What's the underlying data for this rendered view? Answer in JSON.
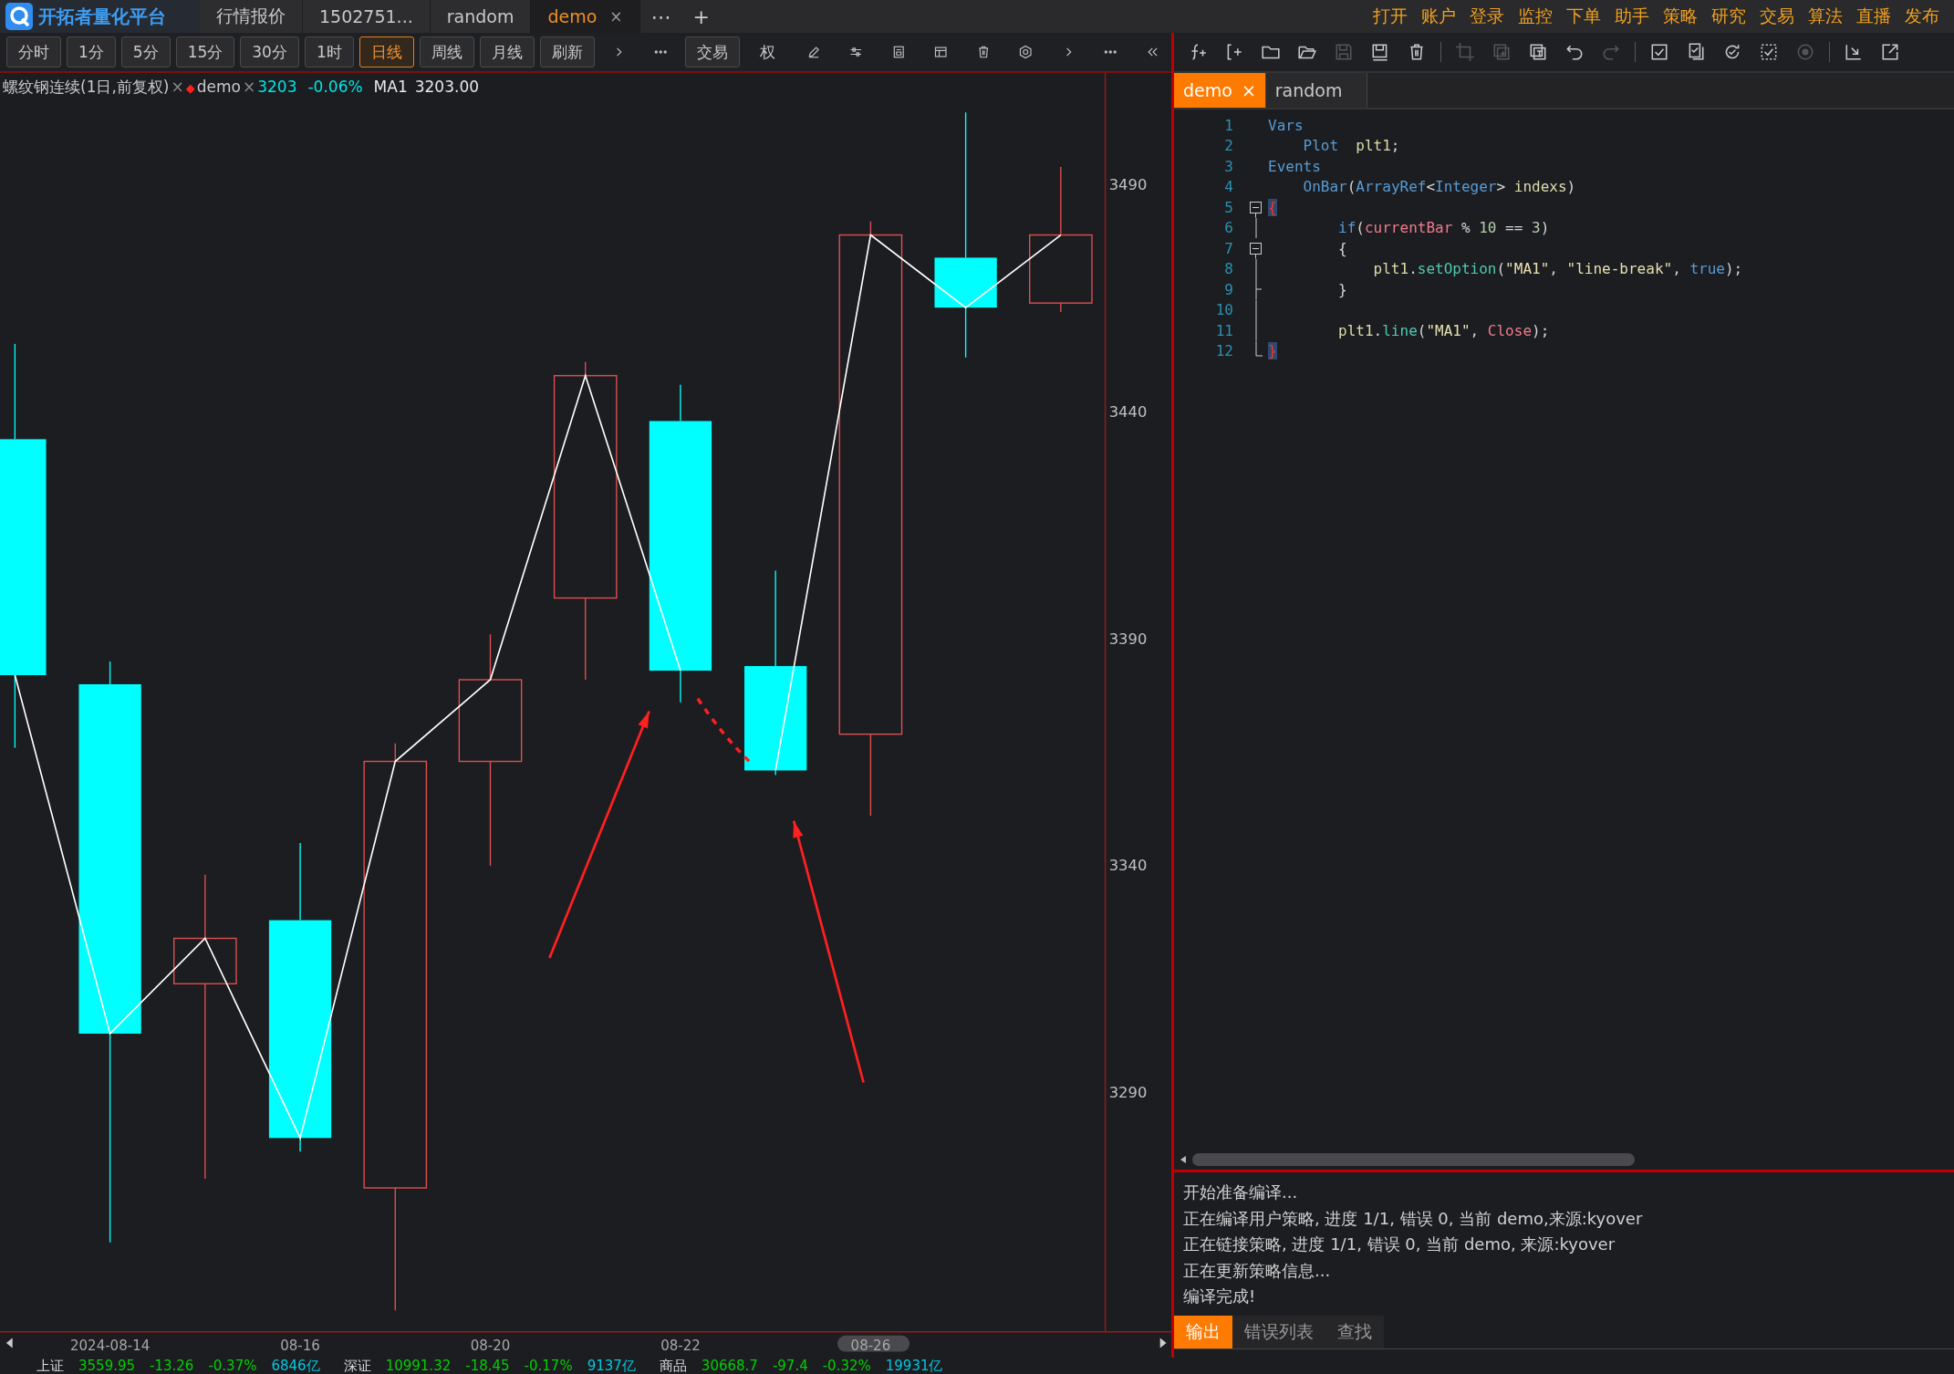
{
  "app": {
    "title": "开拓者量化平台",
    "tabs": [
      {
        "label": "行情报价",
        "selected": false
      },
      {
        "label": "1502751...",
        "selected": false
      },
      {
        "label": "random",
        "selected": false
      },
      {
        "label": "demo",
        "selected": true,
        "close": "×"
      }
    ],
    "more": "⋯",
    "add": "+",
    "menu": [
      "打开",
      "账户",
      "登录",
      "监控",
      "下单",
      "助手",
      "策略",
      "研究",
      "交易",
      "算法",
      "直播",
      "发布"
    ]
  },
  "chart_toolbar": {
    "periods": [
      {
        "label": "分时",
        "selected": false
      },
      {
        "label": "1分",
        "selected": false
      },
      {
        "label": "5分",
        "selected": false
      },
      {
        "label": "15分",
        "selected": false
      },
      {
        "label": "30分",
        "selected": false
      },
      {
        "label": "1时",
        "selected": false
      },
      {
        "label": "日线",
        "selected": true
      },
      {
        "label": "周线",
        "selected": false
      },
      {
        "label": "月线",
        "selected": false
      },
      {
        "label": "刷新",
        "selected": false
      }
    ],
    "tools": [
      {
        "kind": "chevron-right"
      },
      {
        "kind": "more"
      },
      {
        "kind": "text-button",
        "label": "交易"
      },
      {
        "kind": "text",
        "label": "权"
      },
      {
        "kind": "pencil"
      },
      {
        "kind": "sliders"
      },
      {
        "kind": "document"
      },
      {
        "kind": "window"
      },
      {
        "kind": "trash"
      },
      {
        "kind": "hexagon"
      },
      {
        "kind": "chevron-right"
      },
      {
        "kind": "more"
      },
      {
        "kind": "double-chevron-left"
      }
    ]
  },
  "chart_header": {
    "title": "螺纹钢连续(1日,前复权)",
    "close": "×",
    "marker": "◆",
    "strategy": "demo",
    "strategy_close": "×",
    "price": "3203",
    "change": "-0.06%",
    "indicator_value": "3203.00"
  },
  "chart": {
    "chart_data": {
      "type": "line",
      "categories": [
        null,
        "2024-08-14",
        null,
        "08-16",
        null,
        "08-20",
        null,
        "08-22",
        null,
        "08-26",
        null,
        null
      ],
      "ylim": [
        3237.3,
        3514.7
      ],
      "yticks": [
        3290,
        3340,
        3390,
        3440,
        3490
      ],
      "series": [
        {
          "name": "MA1",
          "color": "#ffffff",
          "values": [
            3382,
            3303,
            3324,
            3280,
            3363,
            3381,
            3448,
            3383,
            null,
            null,
            null,
            null
          ]
        },
        {
          "color": "#ffffff",
          "values": [
            null,
            null,
            null,
            null,
            null,
            null,
            null,
            null,
            3361,
            3479,
            3463,
            3479
          ]
        }
      ]
    },
    "marks": [
      {
        "kind": "arrow"
      },
      {
        "kind": "dashed-arc"
      },
      {
        "kind": "arrow"
      }
    ]
  },
  "editor_toolbar": [
    {
      "kind": "function-add",
      "disabled": false
    },
    {
      "kind": "bracket-add",
      "disabled": false
    },
    {
      "kind": "folder",
      "disabled": false
    },
    {
      "kind": "open-folder",
      "disabled": false
    },
    {
      "kind": "save",
      "disabled": true
    },
    {
      "kind": "save-as",
      "disabled": false
    },
    {
      "kind": "trash",
      "disabled": false
    },
    {
      "kind": "separator"
    },
    {
      "kind": "crop",
      "disabled": true
    },
    {
      "kind": "copy",
      "disabled": true
    },
    {
      "kind": "paste",
      "disabled": false
    },
    {
      "kind": "undo",
      "disabled": false
    },
    {
      "kind": "redo",
      "disabled": true
    },
    {
      "kind": "separator"
    },
    {
      "kind": "checkbox",
      "disabled": false
    },
    {
      "kind": "check-document",
      "disabled": false
    },
    {
      "kind": "refresh-check",
      "disabled": false
    },
    {
      "kind": "dashed-check",
      "disabled": false
    },
    {
      "kind": "stop",
      "disabled": true
    },
    {
      "kind": "separator"
    },
    {
      "kind": "import",
      "disabled": false
    },
    {
      "kind": "export",
      "disabled": false
    }
  ],
  "editor": {
    "tabs": [
      {
        "label": "demo",
        "selected": true,
        "close": "×"
      },
      {
        "label": "random",
        "selected": false
      }
    ],
    "lines": [
      {
        "number": "1",
        "kind": "plain",
        "tokens": [
          {
            "kind": "keyword",
            "text": "Vars"
          }
        ]
      },
      {
        "number": "2",
        "kind": "plain",
        "tokens": [
          {
            "kind": "keyword",
            "text": "    Plot"
          },
          {
            "kind": "identifier",
            "text": "  plt1"
          },
          {
            "kind": "plain",
            "text": ";"
          }
        ]
      },
      {
        "number": "3",
        "kind": "plain",
        "tokens": [
          {
            "kind": "keyword",
            "text": "Events"
          }
        ]
      },
      {
        "number": "4",
        "kind": "plain",
        "tokens": [
          {
            "kind": "keyword",
            "text": "    OnBar"
          },
          {
            "kind": "plain",
            "text": "("
          },
          {
            "kind": "keyword",
            "text": "ArrayRef"
          },
          {
            "kind": "plain",
            "text": "<"
          },
          {
            "kind": "keyword",
            "text": "Integer"
          },
          {
            "kind": "plain",
            "text": "> "
          },
          {
            "kind": "identifier",
            "text": "indexs"
          },
          {
            "kind": "plain",
            "text": ")"
          }
        ]
      },
      {
        "number": "5",
        "kind": "fold-open",
        "tokens": [
          {
            "kind": "brace",
            "text": "{"
          }
        ]
      },
      {
        "number": "6",
        "kind": "fold-line",
        "tokens": [
          {
            "kind": "keyword",
            "text": "        if"
          },
          {
            "kind": "plain",
            "text": "("
          },
          {
            "kind": "variable",
            "text": "currentBar"
          },
          {
            "kind": "plain",
            "text": " % "
          },
          {
            "kind": "number",
            "text": "10"
          },
          {
            "kind": "plain",
            "text": " == "
          },
          {
            "kind": "number",
            "text": "3"
          },
          {
            "kind": "plain",
            "text": ")"
          }
        ]
      },
      {
        "number": "7",
        "kind": "fold-open",
        "tokens": [
          {
            "kind": "plain",
            "text": "        {"
          }
        ]
      },
      {
        "number": "8",
        "kind": "fold-line",
        "tokens": [
          {
            "kind": "identifier",
            "text": "            plt1"
          },
          {
            "kind": "plain",
            "text": "."
          },
          {
            "kind": "function",
            "text": "setOption"
          },
          {
            "kind": "plain",
            "text": "("
          },
          {
            "kind": "string",
            "text": "\"MA1\""
          },
          {
            "kind": "plain",
            "text": ", "
          },
          {
            "kind": "string",
            "text": "\"line-break\""
          },
          {
            "kind": "plain",
            "text": ", "
          },
          {
            "kind": "keyword",
            "text": "true"
          },
          {
            "kind": "plain",
            "text": ");"
          }
        ]
      },
      {
        "number": "9",
        "kind": "fold-tick",
        "tokens": [
          {
            "kind": "plain",
            "text": "        }"
          }
        ]
      },
      {
        "number": "10",
        "kind": "fold-line"
      },
      {
        "number": "11",
        "kind": "fold-line",
        "tokens": [
          {
            "kind": "identifier",
            "text": "        plt1"
          },
          {
            "kind": "plain",
            "text": "."
          },
          {
            "kind": "function",
            "text": "line"
          },
          {
            "kind": "plain",
            "text": "("
          },
          {
            "kind": "string",
            "text": "\"MA1\""
          },
          {
            "kind": "plain",
            "text": ", "
          },
          {
            "kind": "variable",
            "text": "Close"
          },
          {
            "kind": "plain",
            "text": ");"
          }
        ]
      },
      {
        "number": "12",
        "kind": "fold-end",
        "tokens": [
          {
            "kind": "brace",
            "text": "}"
          }
        ]
      }
    ]
  },
  "output": {
    "lines": [
      "开始准备编译...",
      "正在编译用户策略, 进度 1/1, 错误 0, 当前 demo,来源:kyover",
      "正在链接策略, 进度 1/1, 错误 0, 当前 demo, 来源:kyover",
      "正在更新策略信息...",
      "编译完成!"
    ],
    "tabs": [
      {
        "label": "输出",
        "selected": true
      },
      {
        "label": "错误列表",
        "selected": false
      },
      {
        "label": "查找",
        "selected": false
      }
    ]
  },
  "status_bar": [
    {
      "name": "上证",
      "price": "3559.95",
      "change": "-13.26",
      "percent": "-0.37%",
      "volume": "6846亿"
    },
    {
      "name": "深证",
      "price": "10991.32",
      "change": "-18.45",
      "percent": "-0.17%",
      "volume": "9137亿"
    },
    {
      "name": "商品",
      "price": "30668.7",
      "change": "-97.4",
      "percent": "-0.32%",
      "volume": "19931亿"
    }
  ]
}
